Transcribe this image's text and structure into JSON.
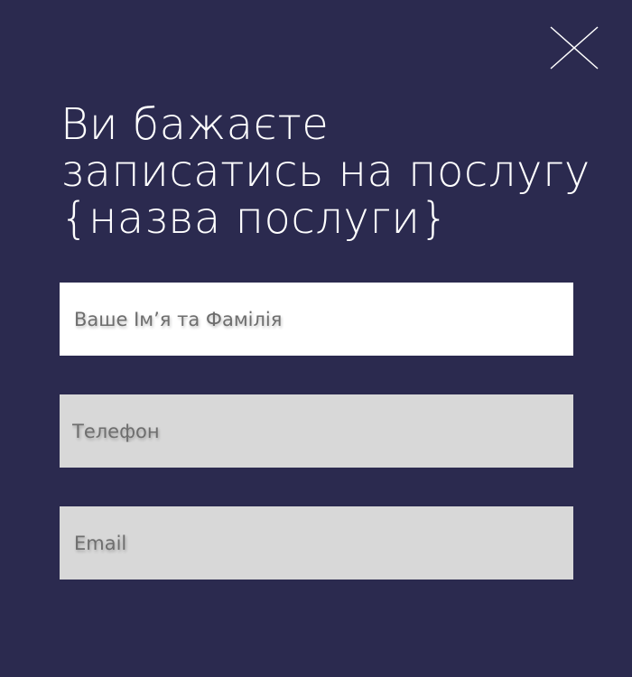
{
  "modal": {
    "title": "Ви бажаєте записатись на послугу {назва послуги}",
    "close_icon": "close-icon",
    "fields": {
      "name": {
        "value": "",
        "placeholder": "Ваше Ім’я та Фамілія"
      },
      "phone": {
        "value": "",
        "placeholder": "Телефон"
      },
      "email": {
        "value": "",
        "placeholder": "Email"
      }
    }
  },
  "colors": {
    "background": "#2b2a4f",
    "title": "#ffffff",
    "active_field": "#ffffff",
    "inactive_field": "#d8d8d8"
  }
}
